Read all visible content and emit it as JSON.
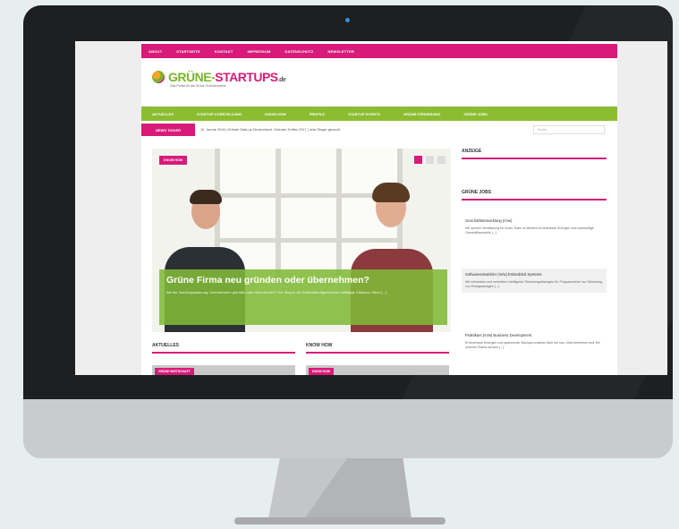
{
  "colors": {
    "accent_pink": "#d81b7a",
    "accent_green": "#8cbd31"
  },
  "topbar": {
    "items": [
      "ABOUT",
      "STARTSEITE",
      "KONTAKT",
      "IMPRESSUM",
      "DATENSCHUTZ",
      "NEWSLETTER"
    ]
  },
  "brand": {
    "logo_green": "GRÜNE-",
    "logo_pink": "STARTUPS",
    "logo_suffix": ".de",
    "tagline": "Das Portal für die Grüne Gründerszene"
  },
  "mainnav": {
    "items": [
      "AKTUELLES",
      "STARTUP-VORSTELLUNG",
      "KNOW HOW",
      "PROFILE",
      "STARTUP-EVENTS",
      "GRÜNE FÖRDERUNG",
      "GRÜNE JOBS"
    ]
  },
  "ticker": {
    "label": "NEWS TICKER",
    "text": "10. Januar 2018 | Gründe Start-up Deutschland: Gründer-Treffen 2017 | Jetzt Sieger gesucht",
    "search_placeholder": "Suche"
  },
  "hero": {
    "badge": "KNOW HOW",
    "title": "Grüne Firma neu gründen oder übernehmen?",
    "excerpt": "Bei der Nachfolgeplanung: Unternehmen gründen oder übernehmen? Der Weg in die Selbstständigkeit bietet vielfältige Chancen. Mehr [...]"
  },
  "sections": {
    "news": "AKTUELLES",
    "knowhow": "KNOW HOW",
    "news_badge": "GRÜNE WIRTSCHAFT",
    "knowhow_badge": "KNOW HOW"
  },
  "sidebar": {
    "title1": "ANZEIGE",
    "title2": "GRÜNE JOBS",
    "jobs": [
      {
        "title": "Geschäftsentwicklung (m/w)",
        "desc": "Wir suchen Verstärkung für unser Team im Bereich Erneuerbare Energien und nachhaltige Geschäftsmodelle [...]"
      },
      {
        "title": "Softwareentwickler (m/w) Embedded Systeme",
        "desc": "Wir entwickeln und vertreiben intelligente Steuerungslösungen für Programmierer zur Steuerung von Energieanlagen [...]"
      },
      {
        "title": "Praktikant (m/w) Business Development",
        "desc": "Erneuerbare Energien und spannende Startups erwarten dich bei uns. Jetzt bewerben und Teil unseres Teams werden [...]"
      }
    ]
  }
}
